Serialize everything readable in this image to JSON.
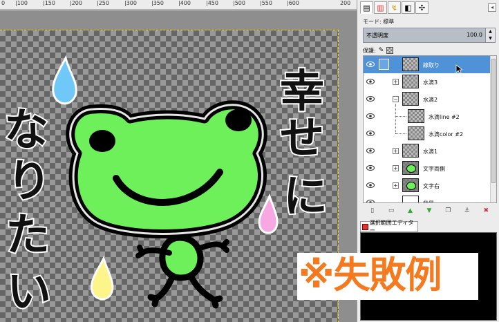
{
  "ruler": {
    "labels": [
      "0",
      "|100",
      "|150",
      "|200",
      "|250",
      "|300",
      "|350",
      "|400",
      "|450",
      "|500",
      "|550",
      "|600",
      "200"
    ]
  },
  "canvas": {
    "artwork_text": "幸せになりたい",
    "colors": {
      "frog": "#6ef05a",
      "outline": "#000000",
      "drop_blue": "#6fc8f7",
      "drop_pink": "#f7a8e3",
      "drop_yellow": "#fdf58a"
    }
  },
  "dock": {
    "mode_label": "モード:",
    "mode_value": "標準",
    "opacity_label": "不透明度",
    "opacity_value": "100.0",
    "lock_label": "保護:",
    "tabs": [
      "layers-tab",
      "channels-tab",
      "paths-tab",
      "gradient-tab",
      "tool-tab"
    ],
    "layers": [
      {
        "name": "線取り",
        "selected": true,
        "thumb": "checker"
      },
      {
        "name": "水滴3",
        "expand": "+",
        "thumb": "checker"
      },
      {
        "name": "水滴2",
        "expand": "−",
        "thumb": "checker"
      },
      {
        "name": "水滴line #2",
        "child": true,
        "thumb": "checker"
      },
      {
        "name": "水滴color #2",
        "child": true,
        "thumb": "checker"
      },
      {
        "name": "水滴1",
        "expand": "+",
        "thumb": "checker"
      },
      {
        "name": "文字両側",
        "expand": "+",
        "thumb": "frog"
      },
      {
        "name": "文字右",
        "expand": "+",
        "thumb": "frog"
      },
      {
        "name": "背景",
        "thumb": "white"
      }
    ],
    "selection_editor_label": "選択範囲エディター"
  },
  "annotation": {
    "fail_text": "※失敗例",
    "color": "#f47a1f"
  }
}
